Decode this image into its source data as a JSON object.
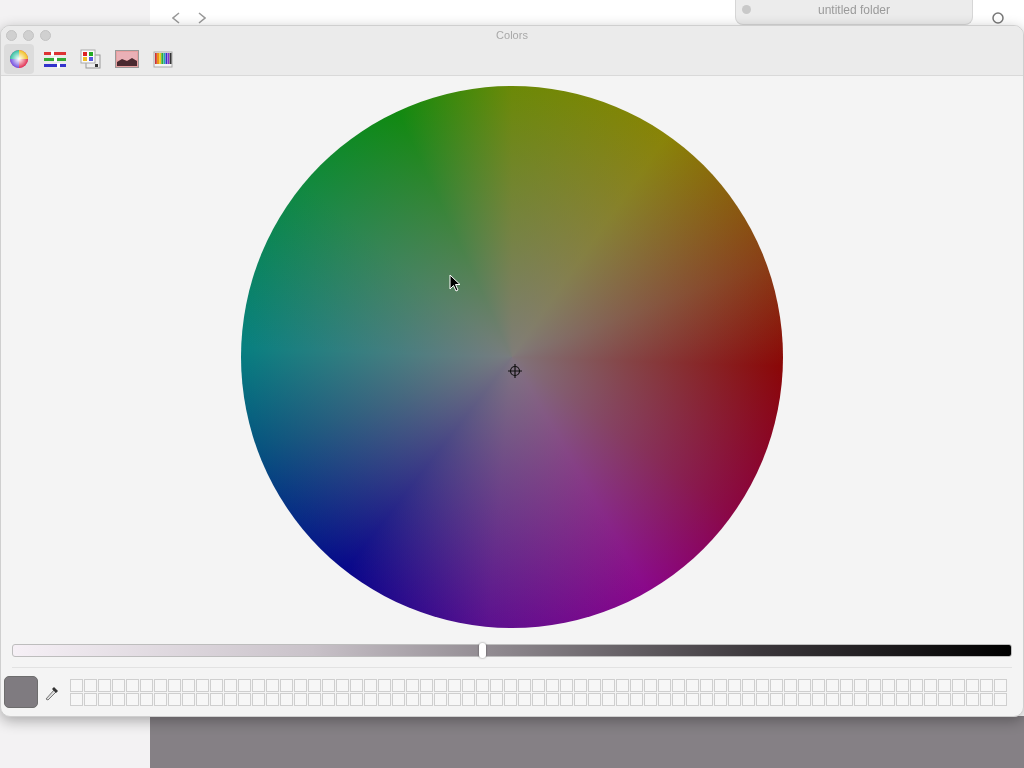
{
  "finder": {
    "tab_title": "untitled folder"
  },
  "window": {
    "title": "Colors"
  },
  "modes": [
    {
      "kind": "wheel",
      "selected": true
    },
    {
      "kind": "sliders",
      "selected": false
    },
    {
      "kind": "palettes",
      "selected": false
    },
    {
      "kind": "image",
      "selected": false
    },
    {
      "kind": "pencils",
      "selected": false
    }
  ],
  "brightness": {
    "level": 0.47
  }
}
